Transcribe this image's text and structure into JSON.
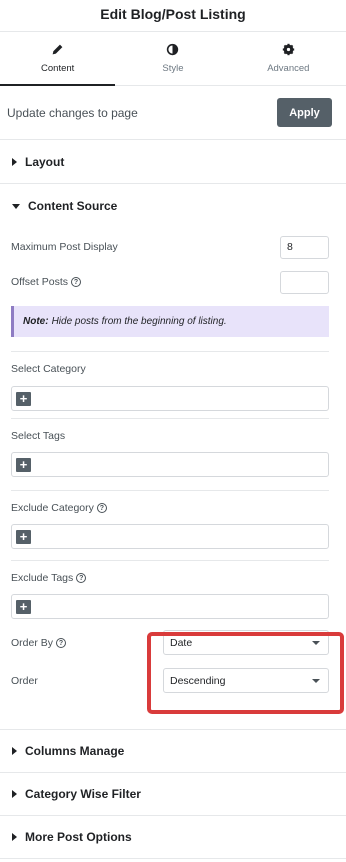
{
  "header": {
    "title": "Edit Blog/Post Listing"
  },
  "tabs": [
    {
      "label": "Content",
      "icon": "pencil-icon"
    },
    {
      "label": "Style",
      "icon": "contrast-icon"
    },
    {
      "label": "Advanced",
      "icon": "gear-icon"
    }
  ],
  "apply_row": {
    "label": "Update changes to page",
    "button": "Apply"
  },
  "sections": {
    "layout": "Layout",
    "content_source": "Content Source",
    "columns_manage": "Columns Manage",
    "category_filter": "Category Wise Filter",
    "more_post_options": "More Post Options"
  },
  "content_source": {
    "max_post_label": "Maximum Post Display",
    "max_post_value": "8",
    "offset_label": "Offset Posts",
    "offset_value": "",
    "note_bold": "Note:",
    "note_text": "Hide posts from the beginning of listing.",
    "select_category": "Select Category",
    "select_tags": "Select Tags",
    "exclude_category": "Exclude Category",
    "exclude_tags": "Exclude Tags",
    "order_by_label": "Order By",
    "order_by_value": "Date",
    "order_label": "Order",
    "order_value": "Descending"
  },
  "colors": {
    "accent": "#556068",
    "highlight": "#d93b3b",
    "note_bg": "#e8e3fa"
  }
}
